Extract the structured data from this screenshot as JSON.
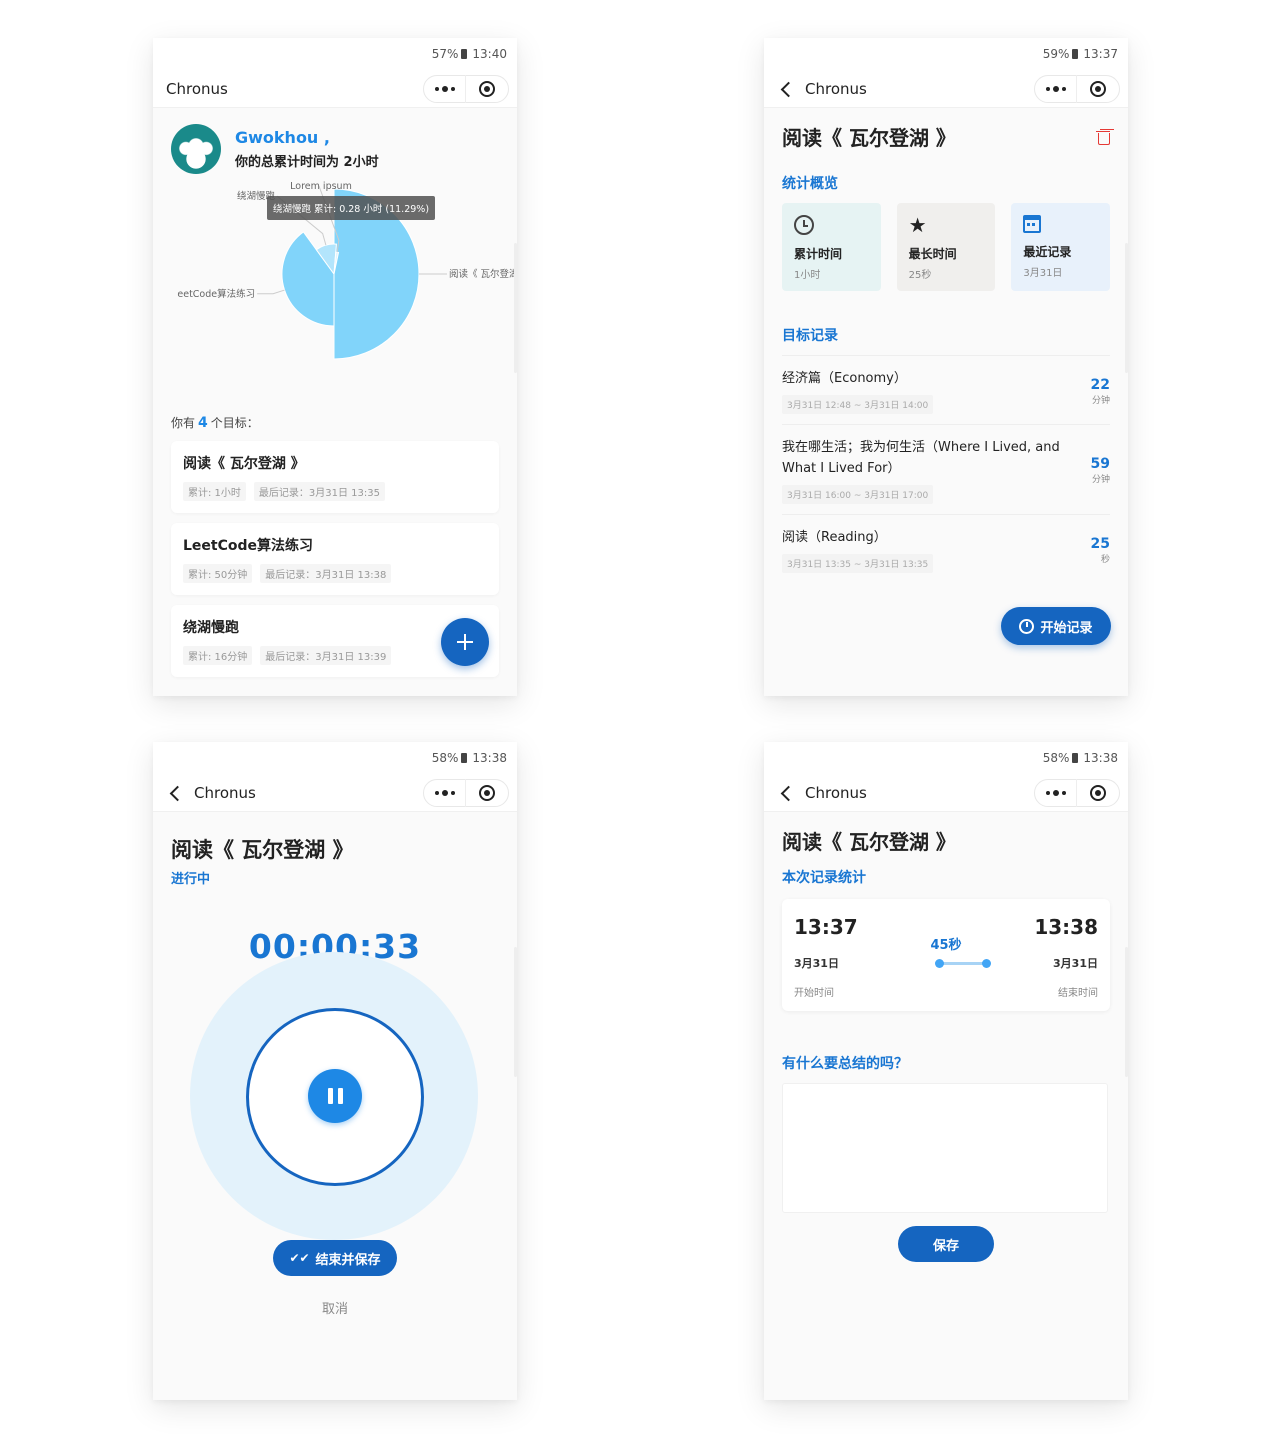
{
  "status": {
    "p1": {
      "battery": "57%",
      "time": "13:40"
    },
    "p2": {
      "battery": "59%",
      "time": "13:37"
    },
    "p3": {
      "battery": "58%",
      "time": "13:38"
    },
    "p4": {
      "battery": "58%",
      "time": "13:38"
    }
  },
  "app": {
    "title": "Chronus"
  },
  "home": {
    "user_name": "Gwokhou ,",
    "total_line": "你的总累计时间为 2小时",
    "goal_count_prefix": "你有",
    "goal_count": "4",
    "goal_count_suffix": "个目标：",
    "goals": [
      {
        "title": "阅读《 瓦尔登湖 》",
        "total": "累计: 1小时",
        "last": "最后记录：3月31日 13:35"
      },
      {
        "title": "LeetCode算法练习",
        "total": "累计: 50分钟",
        "last": "最后记录：3月31日 13:38"
      },
      {
        "title": "绕湖慢跑",
        "total": "累计: 16分钟",
        "last": "最后记录：3月31日 13:39"
      }
    ]
  },
  "chart_data": {
    "type": "pie",
    "subtype": "rose",
    "title": "",
    "series": [
      {
        "name": "阅读《 瓦尔登湖 》",
        "label": "阅读《 瓦尔登湖 》",
        "share": 0.5
      },
      {
        "name": "LeetCode算法练习",
        "label": "eetCode算法练习",
        "share": 0.4
      },
      {
        "name": "绕湖慢跑",
        "label": "绕湖慢跑",
        "share": 0.1129,
        "value_hours": 0.28
      },
      {
        "name": "Lorem ipsum",
        "label": "Lorem ipsum",
        "share": 0.02
      }
    ],
    "colors": [
      "#81d4fa",
      "#81d4fa",
      "#b3e5fc",
      "#e1f5fe"
    ],
    "tooltip": "绕湖慢跑   累计: 0.28 小时 (11.29%)"
  },
  "detail": {
    "title": "阅读《 瓦尔登湖 》",
    "overview_title": "统计概览",
    "tiles": [
      {
        "label": "累计时间",
        "value": "1小时",
        "bg": "#e6f3f3"
      },
      {
        "label": "最长时间",
        "value": "25秒",
        "bg": "#f0efed"
      },
      {
        "label": "最近记录",
        "value": "3月31日",
        "bg": "#e8f1fb"
      }
    ],
    "records_title": "目标记录",
    "records": [
      {
        "title": "经济篇（Economy）",
        "time": "3月31日 12:48 ~ 3月31日 14:00",
        "num": "22",
        "unit": "分钟"
      },
      {
        "title": "我在哪生活；我为何生活（Where I Lived, and What I Lived For）",
        "time": "3月31日 16:00 ~ 3月31日 17:00",
        "num": "59",
        "unit": "分钟"
      },
      {
        "title": "阅读（Reading）",
        "time": "3月31日 13:35 ~ 3月31日 13:35",
        "num": "25",
        "unit": "秒"
      }
    ],
    "start_label": "开始记录"
  },
  "running": {
    "title": "阅读《 瓦尔登湖 》",
    "status": "进行中",
    "timer": "00:00:33",
    "finish_label": "结束并保存",
    "cancel_label": "取消"
  },
  "summary": {
    "title": "阅读《 瓦尔登湖 》",
    "section_title": "本次记录统计",
    "start_time": "13:37",
    "end_time": "13:38",
    "start_date": "3月31日",
    "end_date": "3月31日",
    "start_label": "开始时间",
    "end_label": "结束时间",
    "duration": "45秒",
    "question": "有什么要总结的吗？",
    "note_value": "",
    "save_label": "保存"
  }
}
